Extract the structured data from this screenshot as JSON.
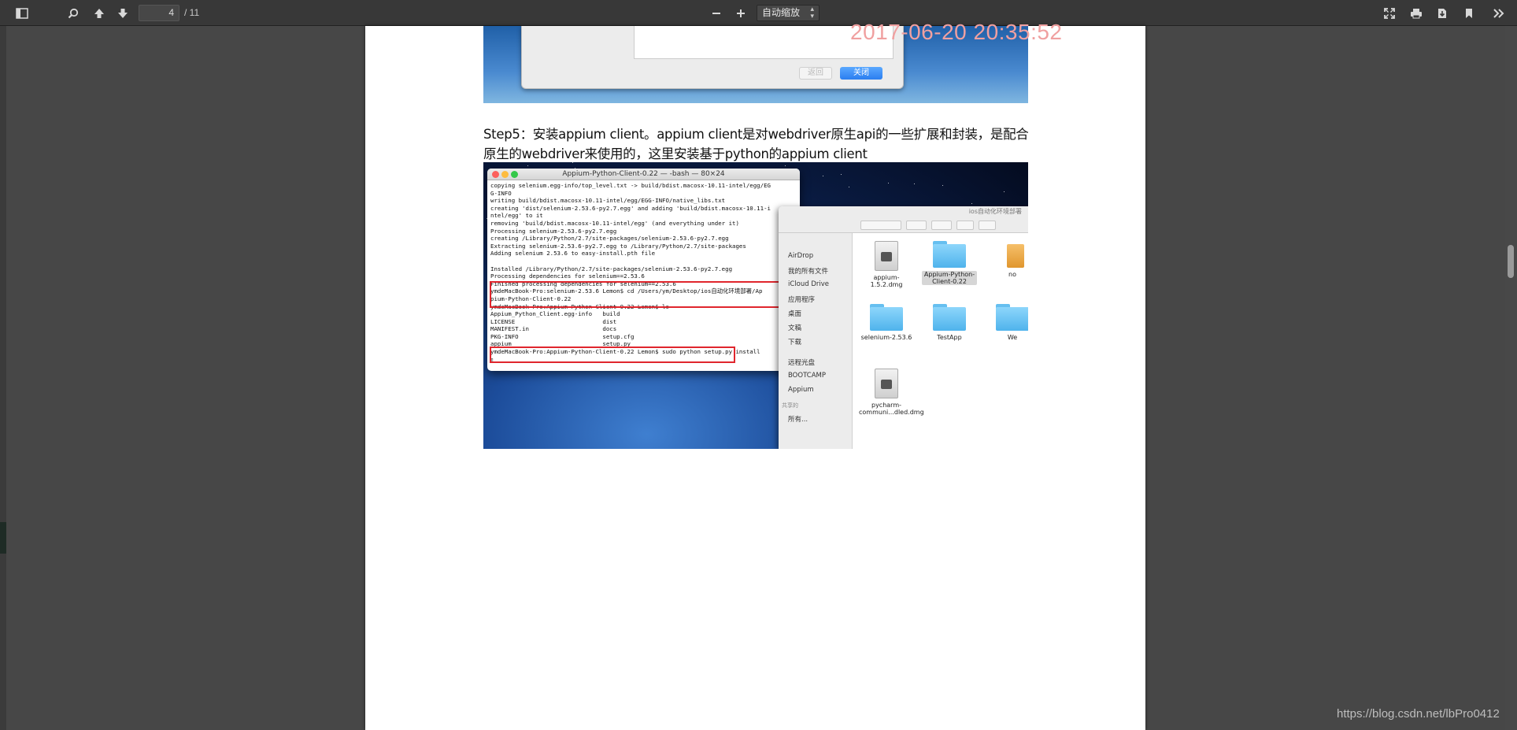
{
  "toolbar": {
    "page_number": "4",
    "page_count": "/ 11",
    "zoom": "自动缩放"
  },
  "document": {
    "timestamp": "2017-06-20 20:35:52",
    "dialog": {
      "back_button": "返回",
      "close_button": "关闭"
    },
    "step_text": "Step5：安装appium client。appium client是对webdriver原生api的一些扩展和封装，是配合原生的webdriver来使用的，这里安装基于python的appium client",
    "terminal": {
      "title": "Appium-Python-Client-0.22 — -bash — 80×24",
      "lines": [
        "copying selenium.egg-info/top_level.txt -> build/bdist.macosx-10.11-intel/egg/EG",
        "G-INFO",
        "writing build/bdist.macosx-10.11-intel/egg/EGG-INFO/native_libs.txt",
        "creating 'dist/selenium-2.53.6-py2.7.egg' and adding 'build/bdist.macosx-10.11-i",
        "ntel/egg' to it",
        "removing 'build/bdist.macosx-10.11-intel/egg' (and everything under it)",
        "Processing selenium-2.53.6-py2.7.egg",
        "creating /Library/Python/2.7/site-packages/selenium-2.53.6-py2.7.egg",
        "Extracting selenium-2.53.6-py2.7.egg to /Library/Python/2.7/site-packages",
        "Adding selenium 2.53.6 to easy-install.pth file",
        "",
        "Installed /Library/Python/2.7/site-packages/selenium-2.53.6-py2.7.egg",
        "Processing dependencies for selenium==2.53.6",
        "Finished processing dependencies for selenium==2.53.6",
        "ymdeMacBook-Pro:selenium-2.53.6 Lemon$ cd /Users/ym/Desktop/ios自动化环境部署/Ap",
        "pium-Python-Client-0.22",
        "ymdeMacBook-Pro:Appium-Python-Client-0.22 Lemon$ ls",
        "Appium_Python_Client.egg-info   build",
        "LICENSE                         dist",
        "MANIFEST.in                     docs",
        "PKG-INFO                        setup.cfg",
        "appium                          setup.py",
        "ymdeMacBook-Pro:Appium-Python-Client-0.22 Lemon$ sudo python setup.py install",
        "▯"
      ]
    },
    "finder": {
      "title": "ios自动化环境部署",
      "sidebar": [
        "AirDrop",
        "我的所有文件",
        "iCloud Drive",
        "应用程序",
        "桌面",
        "文稿",
        "下载",
        "远程光盘",
        "BOOTCAMP",
        "Appium",
        "共享的",
        "所有..."
      ],
      "items": [
        {
          "label": "appium-1.5.2.dmg",
          "kind": "dmg"
        },
        {
          "label": "Appium-Python-Client-0.22",
          "kind": "folder"
        },
        {
          "label": "no",
          "kind": "other"
        },
        {
          "label": "selenium-2.53.6",
          "kind": "folder"
        },
        {
          "label": "TestApp",
          "kind": "folder"
        },
        {
          "label": "We",
          "kind": "folder"
        },
        {
          "label": "pycharm-communi...dled.dmg",
          "kind": "dmg"
        }
      ]
    }
  },
  "watermark": "https://blog.csdn.net/lbPro0412"
}
